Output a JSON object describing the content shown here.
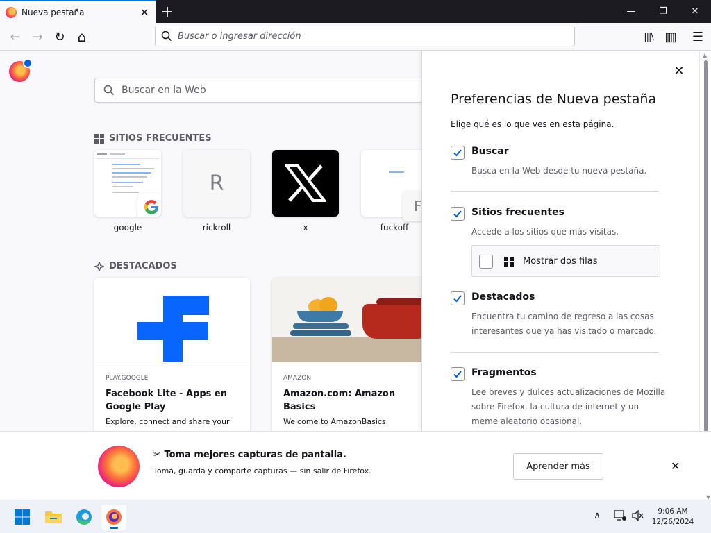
{
  "tab": {
    "title": "Nueva pestaña",
    "close": "✕",
    "new": "+"
  },
  "window": {
    "minimize": "—",
    "maximize": "❐",
    "close": "✕"
  },
  "navbar": {
    "back": "←",
    "forward": "→",
    "reload": "↻",
    "home": "⌂",
    "url_placeholder": "Buscar o ingresar dirección",
    "library": "|||\\",
    "sidebar": "▥",
    "menu": "☰"
  },
  "content": {
    "search_placeholder": "Buscar en la Web",
    "top_sites_title": "SITIOS FRECUENTES",
    "top_sites": [
      {
        "label": "google"
      },
      {
        "label": "rickroll",
        "letter": "R"
      },
      {
        "label": "x"
      },
      {
        "label": "fuckoff",
        "letter": "F"
      }
    ],
    "highlights_title": "DESTACADOS",
    "highlights": [
      {
        "source": "PLAY.GOOGLE",
        "title": "Facebook Lite - Apps en Google Play",
        "desc": "Explore, connect and share your"
      },
      {
        "source": "AMAZON",
        "title": "Amazon.com: Amazon Basics",
        "desc": "Welcome to AmazonBasics"
      }
    ]
  },
  "prefs": {
    "close": "✕",
    "title": "Preferencias de Nueva pestaña",
    "subtitle": "Elige qué es lo que ves en esta página.",
    "options": [
      {
        "name": "Buscar",
        "desc": "Busca en la Web desde tu nueva pestaña.",
        "checked": true
      },
      {
        "name": "Sitios frecuentes",
        "desc": "Accede a los sitios que más visitas.",
        "checked": true
      },
      {
        "name": "Destacados",
        "desc": "Encuentra tu camino de regreso a las cosas interesantes que ya has visitado o marcado.",
        "checked": true
      },
      {
        "name": "Fragmentos",
        "desc": "Lee breves y dulces actualizaciones de Mozilla sobre Firefox, la cultura de internet y un meme aleatorio ocasional.",
        "checked": true
      }
    ],
    "two_rows": {
      "label": "Mostrar dos filas",
      "checked": false
    }
  },
  "notification": {
    "heading": "Toma mejores capturas de pantalla.",
    "icon": "✂",
    "text": "Toma, guarda y comparte capturas — sin salir de Firefox.",
    "button": "Aprender más",
    "close": "✕"
  },
  "taskbar": {
    "chevron": "∧",
    "time": "9:06 AM",
    "date": "12/26/2024"
  }
}
